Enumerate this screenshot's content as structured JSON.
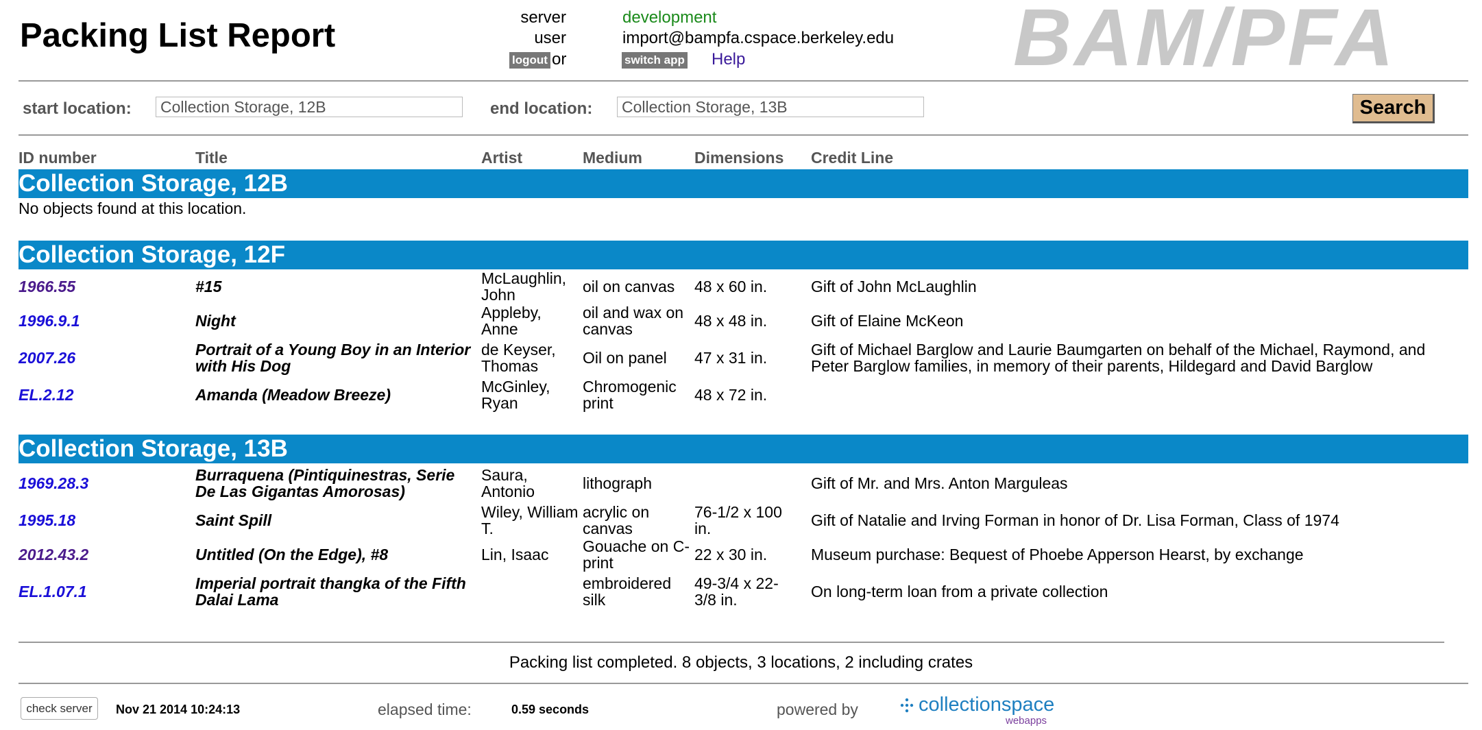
{
  "header": {
    "title": "Packing List Report",
    "server_label": "server",
    "server_value": "development",
    "user_label": "user",
    "user_value": "import@bampfa.cspace.berkeley.edu",
    "logout_label": "logout",
    "or_text": "or",
    "switch_app_label": "switch app",
    "help_label": "Help",
    "logo_text": "BAM/PFA"
  },
  "search": {
    "start_label": "start location:",
    "start_value": "Collection Storage, 12B",
    "end_label": "end location:",
    "end_value": "Collection Storage, 13B",
    "button_label": "Search"
  },
  "columns": {
    "id": "ID number",
    "title": "Title",
    "artist": "Artist",
    "medium": "Medium",
    "dimensions": "Dimensions",
    "credit": "Credit Line"
  },
  "locations": [
    {
      "name": "Collection Storage, 12B",
      "empty_note": "No objects found at this location."
    },
    {
      "name": "Collection Storage, 12F",
      "rows": [
        {
          "id": "1966.55",
          "title": "#15",
          "artist": "McLaughlin, John",
          "medium": "oil on canvas",
          "dimensions": "48 x 60 in.",
          "credit": "Gift of John McLaughlin"
        },
        {
          "id": "1996.9.1",
          "title": "Night",
          "artist": "Appleby, Anne",
          "medium": "oil and wax on canvas",
          "dimensions": "48 x 48 in.",
          "credit": "Gift of Elaine McKeon"
        },
        {
          "id": "2007.26",
          "title": "Portrait of a Young Boy in an Interior with His Dog",
          "artist": "de Keyser, Thomas",
          "medium": "Oil on panel",
          "dimensions": "47 x 31 in.",
          "credit": "Gift of Michael Barglow and Laurie Baumgarten on behalf of the Michael, Raymond, and Peter Barglow families, in memory of their parents, Hildegard and David Barglow"
        },
        {
          "id": "EL.2.12",
          "title": "Amanda (Meadow Breeze)",
          "artist": "McGinley, Ryan",
          "medium": "Chromogenic print",
          "dimensions": "48 x 72 in.",
          "credit": ""
        }
      ]
    },
    {
      "name": "Collection Storage, 13B",
      "rows": [
        {
          "id": "1969.28.3",
          "title": "Burraquena (Pintiquinestras, Serie De Las Gigantas Amorosas)",
          "artist": "Saura, Antonio",
          "medium": "lithograph",
          "dimensions": "",
          "credit": "Gift of Mr. and Mrs. Anton Marguleas"
        },
        {
          "id": "1995.18",
          "title": "Saint Spill",
          "artist": "Wiley, William T.",
          "medium": "acrylic on canvas",
          "dimensions": "76-1/2 x 100 in.",
          "credit": "Gift of Natalie and Irving Forman in honor of Dr. Lisa Forman, Class of 1974"
        },
        {
          "id": "2012.43.2",
          "title": "Untitled (On the Edge), #8",
          "artist": "Lin, Isaac",
          "medium": "Gouache on C-print",
          "dimensions": "22 x 30 in.",
          "credit": "Museum purchase: Bequest of Phoebe Apperson Hearst, by exchange"
        },
        {
          "id": "EL.1.07.1",
          "title": "Imperial portrait thangka of the Fifth Dalai Lama",
          "artist": "",
          "medium": "embroidered silk",
          "dimensions": "49-3/4 x 22-3/8 in.",
          "credit": "On long-term loan from a private collection"
        }
      ]
    }
  ],
  "footer": {
    "summary": "Packing list completed. 8 objects, 3 locations, 2 including crates",
    "check_server_label": "check server",
    "timestamp": "Nov 21 2014 10:24:13",
    "elapsed_label": "elapsed time:",
    "elapsed_value": "0.59 seconds",
    "powered_label": "powered by",
    "cs_logo_text": "collectionspace",
    "cs_logo_sub": "webapps"
  },
  "colors": {
    "location_bar": "#0a88c8",
    "link": "#1a0fd8",
    "visited_link": "#4b1b8c",
    "server_value": "#1a8a1a",
    "search_button": "#e0bc90"
  }
}
